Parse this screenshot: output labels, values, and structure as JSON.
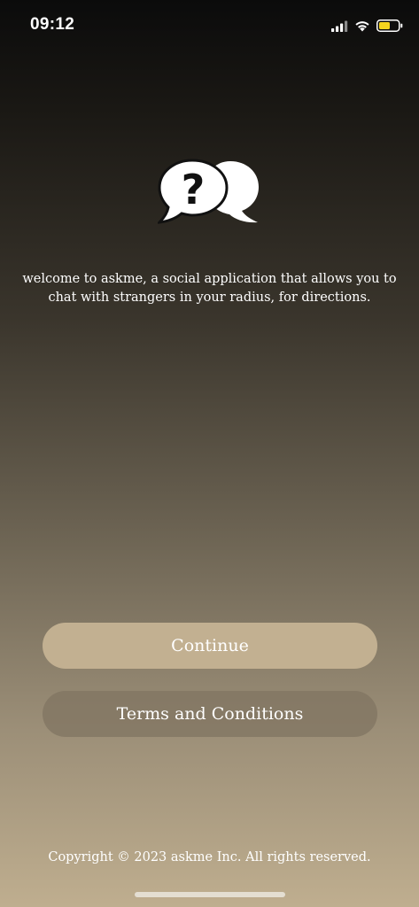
{
  "status_bar": {
    "time": "09:12",
    "icons": [
      "signal-icon",
      "wifi-icon",
      "battery-icon"
    ],
    "battery_color": "#f5d51f"
  },
  "logo": {
    "icon": "chat-bubbles-question-icon",
    "glyph": "?"
  },
  "welcome": {
    "text": "welcome to askme, a social application that allows you to chat with strangers in your radius, for directions."
  },
  "buttons": {
    "continue_label": "Continue",
    "terms_label": "Terms and Conditions"
  },
  "footer": {
    "copyright": "Copyright © 2023 askme Inc. All rights reserved."
  },
  "colors": {
    "primary_button": "#c2b091",
    "secondary_button": "#807461"
  }
}
